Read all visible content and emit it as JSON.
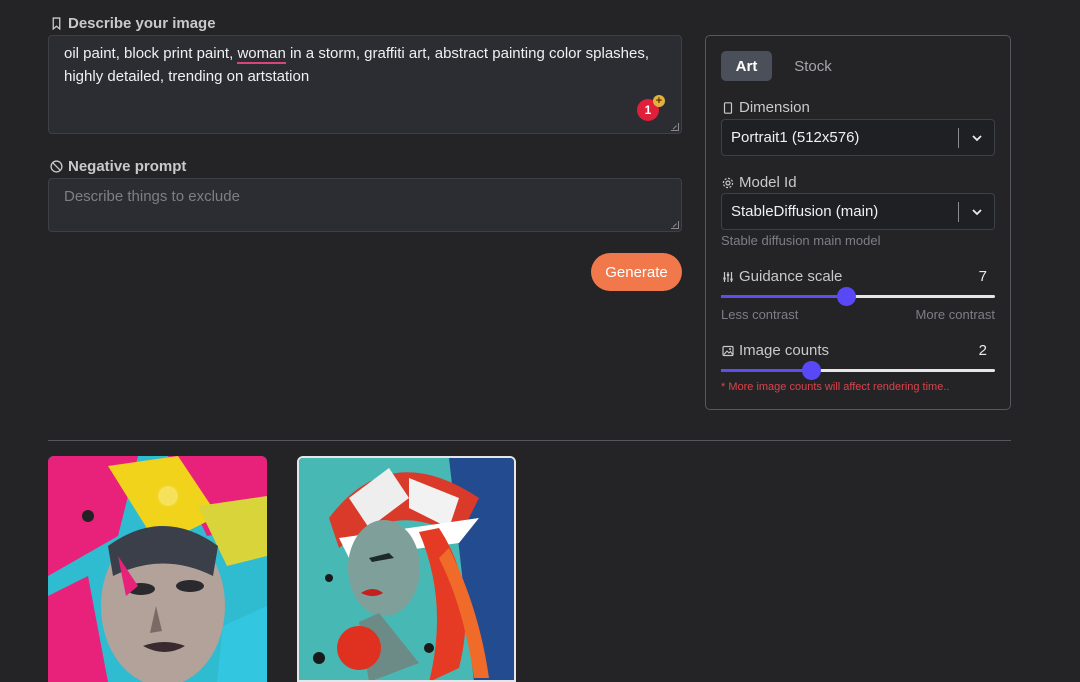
{
  "prompt": {
    "label": "Describe your image",
    "text_before": "oil paint, block print paint, ",
    "text_underlined": "woman",
    "text_after": " in a storm, graffiti art, abstract painting color splashes, highly detailed, trending on artstation",
    "badge_count": "1",
    "badge_plus": "+"
  },
  "negative": {
    "label": "Negative prompt",
    "placeholder": "Describe things to exclude"
  },
  "generate_label": "Generate",
  "settings": {
    "tabs": [
      {
        "label": "Art",
        "active": true
      },
      {
        "label": "Stock",
        "active": false
      }
    ],
    "dimension": {
      "label": "Dimension",
      "value": "Portrait1 (512x576)"
    },
    "model": {
      "label": "Model Id",
      "value": "StableDiffusion (main)",
      "hint": "Stable diffusion main model"
    },
    "guidance": {
      "label": "Guidance scale",
      "value": "7",
      "fraction": 0.455,
      "min_label": "Less contrast",
      "max_label": "More contrast"
    },
    "image_counts": {
      "label": "Image counts",
      "value": "2",
      "fraction": 0.33,
      "warning": "* More image counts will affect rendering time.."
    }
  },
  "icons": {
    "prompt": "bookmark-icon",
    "negative": "ban-icon",
    "dimension": "portrait-icon",
    "model": "gear-icon",
    "guidance": "sliders-icon",
    "image_counts": "image-icon",
    "select": "chevron-down-icon"
  },
  "colors": {
    "background": "#242426",
    "accent": "#f0784a",
    "slider": "#5848f5",
    "warning": "#d9434b"
  },
  "gallery": [
    {
      "alt": "generated image 1"
    },
    {
      "alt": "generated image 2"
    }
  ]
}
